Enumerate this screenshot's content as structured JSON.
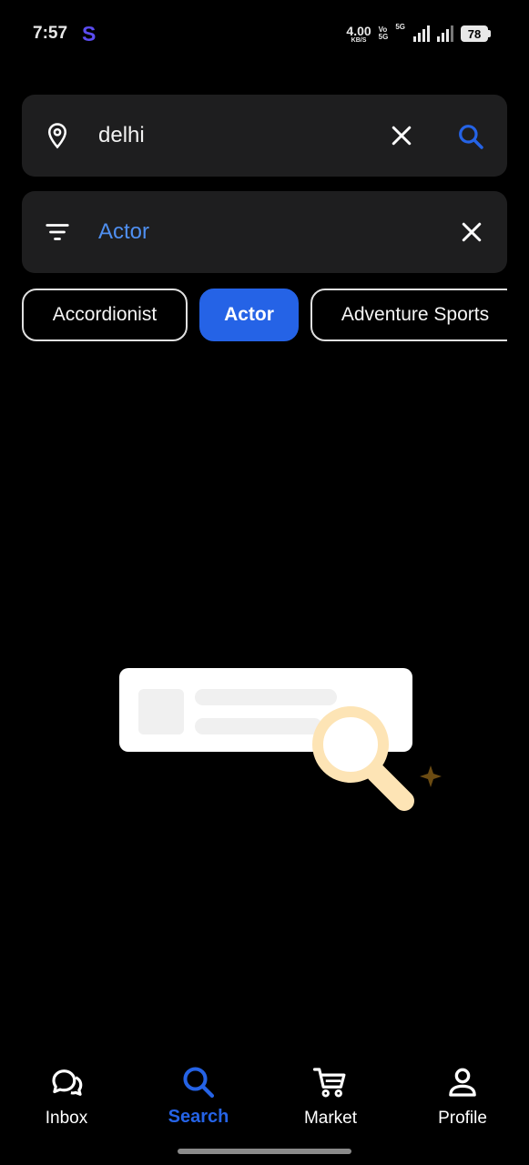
{
  "status_bar": {
    "time": "7:57",
    "app_letter": "S",
    "net_speed": "4.00",
    "net_speed_unit": "KB/S",
    "volte_top": "Vo",
    "volte_bottom": "5G",
    "sim_label": "5G",
    "battery": "78"
  },
  "location_search": {
    "value": "delhi",
    "icons": [
      "location-pin-icon",
      "close-icon",
      "search-icon"
    ]
  },
  "category_filter": {
    "value": "Actor",
    "icons": [
      "filter-icon",
      "close-icon"
    ]
  },
  "chips": [
    {
      "label": "Accordionist",
      "selected": false
    },
    {
      "label": "Actor",
      "selected": true
    },
    {
      "label": "Adventure Sports",
      "selected": false
    }
  ],
  "bottom_nav": {
    "items": [
      {
        "label": "Inbox",
        "icon": "chat-bubbles-icon",
        "active": false
      },
      {
        "label": "Search",
        "icon": "search-icon",
        "active": true
      },
      {
        "label": "Market",
        "icon": "cart-icon",
        "active": false
      },
      {
        "label": "Profile",
        "icon": "person-icon",
        "active": false
      }
    ]
  },
  "colors": {
    "accent": "#2563e6",
    "filter_text": "#4f8ff0",
    "field_bg": "#1e1e1f",
    "status_app": "#5b4cf0"
  }
}
